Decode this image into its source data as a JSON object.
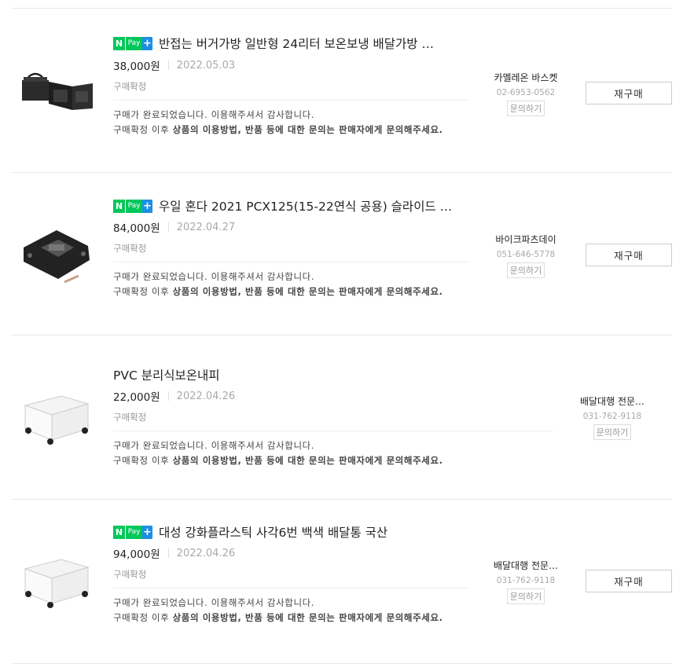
{
  "orders": [
    {
      "npay": true,
      "title": "반접는 버거가방 일반형 24리터 보온보냉 배달가방 …",
      "price": "38,000원",
      "date": "2022.05.03",
      "status": "구매확정",
      "msg_line1": "구매가 완료되었습니다. 이용해주셔서 감사합니다.",
      "msg_prefix": "구매확정 이후 ",
      "msg_bold": "상품의 이용방법, 반품 등에 대한 문의는 판매자에게 문의해주세요.",
      "seller_name": "카멜레온 바스켓",
      "seller_phone": "02-6953-0562",
      "inquiry_label": "문의하기",
      "rebuy_label": "재구매",
      "image": "black-delivery-bag"
    },
    {
      "npay": true,
      "title": "우일 혼다 2021 PCX125(15-22연식 공용) 슬라이드 …",
      "price": "84,000원",
      "date": "2022.04.27",
      "status": "구매확정",
      "msg_line1": "구매가 완료되었습니다. 이용해주셔서 감사합니다.",
      "msg_prefix": "구매확정 이후 ",
      "msg_bold": "상품의 이용방법, 반품 등에 대한 문의는 판매자에게 문의해주세요.",
      "seller_name": "바이크파츠데이",
      "seller_phone": "051-646-5778",
      "inquiry_label": "문의하기",
      "rebuy_label": "재구매",
      "image": "motorcycle-bracket"
    },
    {
      "npay": false,
      "title": "PVC 분리식보온내피",
      "price": "22,000원",
      "date": "2022.04.26",
      "status": "구매확정",
      "msg_line1": "구매가 완료되었습니다. 이용해주셔서 감사합니다.",
      "msg_prefix": "구매확정 이후 ",
      "msg_bold": "상품의 이용방법, 반품 등에 대한 문의는 판매자에게 문의해주세요.",
      "seller_name": "배달대행 전문…",
      "seller_phone": "031-762-9118",
      "inquiry_label": "문의하기",
      "rebuy_label": "",
      "image": "white-box"
    },
    {
      "npay": true,
      "title": "대성 강화플라스틱 사각6번 백색 배달통 국산",
      "price": "94,000원",
      "date": "2022.04.26",
      "status": "구매확정",
      "msg_line1": "구매가 완료되었습니다. 이용해주셔서 감사합니다.",
      "msg_prefix": "구매확정 이후 ",
      "msg_bold": "상품의 이용방법, 반품 등에 대한 문의는 판매자에게 문의해주세요.",
      "seller_name": "배달대행 전문…",
      "seller_phone": "031-762-9118",
      "inquiry_label": "문의하기",
      "rebuy_label": "재구매",
      "image": "white-box"
    }
  ],
  "npay_badge": {
    "n": "N",
    "pay": "Pay",
    "plus": "+"
  },
  "colors": {
    "npay_green": "#03c75a",
    "npay_blue": "#1d8ee6"
  }
}
